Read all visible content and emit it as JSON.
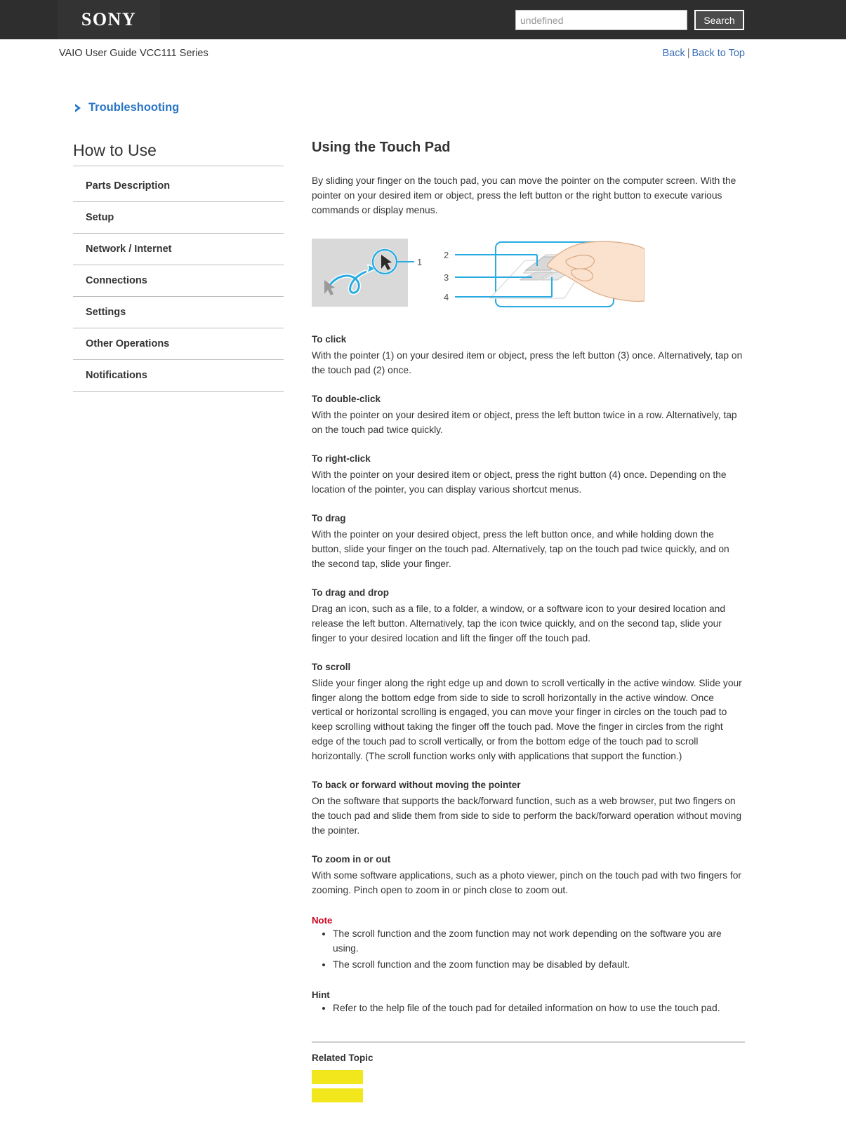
{
  "header": {
    "logo_text": "SONY",
    "search": {
      "value": "",
      "placeholder": "undefined",
      "button_label": "Search"
    },
    "guide_title": "VAIO User Guide VCC111 Series",
    "link_back": "Back",
    "link_separator": "|",
    "link_back_to_top": "Back to Top"
  },
  "breadcrumb": {
    "label": "Troubleshooting",
    "icon": "chevron-right-icon"
  },
  "sidebar": {
    "title": "How to Use",
    "items": [
      {
        "label": "Parts Description"
      },
      {
        "label": "Setup"
      },
      {
        "label": "Network / Internet"
      },
      {
        "label": "Connections"
      },
      {
        "label": "Settings"
      },
      {
        "label": "Other Operations"
      },
      {
        "label": "Notifications"
      }
    ]
  },
  "article": {
    "title": "Using the Touch Pad",
    "intro": "By sliding your finger on the touch pad, you can move the pointer on the computer screen. With the pointer on your desired item or object, press the left button or the right button to execute various commands or display menus.",
    "figures": {
      "left": {
        "name": "pointer-movement-illustration",
        "callouts": [
          "1"
        ]
      },
      "right": {
        "name": "hand-on-touchpad-illustration",
        "callouts": [
          "2",
          "3",
          "4"
        ]
      }
    },
    "sections": [
      {
        "heading": "To click",
        "body": "With the pointer (1) on your desired item or object, press the left button (3) once.\nAlternatively, tap on the touch pad (2) once."
      },
      {
        "heading": "To double-click",
        "body": "With the pointer on your desired item or object, press the left button twice in a row.\nAlternatively, tap on the touch pad twice quickly."
      },
      {
        "heading": "To right-click",
        "body": "With the pointer on your desired item or object, press the right button (4) once.\nDepending on the location of the pointer, you can display various shortcut menus."
      },
      {
        "heading": "To drag",
        "body": "With the pointer on your desired object, press the left button once, and while holding down the button, slide your finger on the touch pad.\nAlternatively, tap on the touch pad twice quickly, and on the second tap, slide your finger."
      },
      {
        "heading": "To drag and drop",
        "body": "Drag an icon, such as a file, to a folder, a window, or a software icon to your desired location and release the left button.\nAlternatively, tap the icon twice quickly, and on the second tap, slide your finger to your desired location and lift the finger off the touch pad."
      },
      {
        "heading": "To scroll",
        "body": "Slide your finger along the right edge up and down to scroll vertically in the active window.\nSlide your finger along the bottom edge from side to side to scroll horizontally in the active window.\nOnce vertical or horizontal scrolling is engaged, you can move your finger in circles on the touch pad to keep scrolling without taking the finger off the touch pad. Move the finger in circles from the right edge of the touch pad to scroll vertically, or from the bottom edge of the touch pad to scroll horizontally. (The scroll function works only with applications that support the function.)"
      },
      {
        "heading": "To back or forward without moving the pointer",
        "body": "On the software that supports the back/forward function, such as a web browser, put two fingers on the touch pad and slide them from side to side to perform the back/forward operation without moving the pointer."
      },
      {
        "heading": "To zoom in or out",
        "body": "With some software applications, such as a photo viewer, pinch on the touch pad with two fingers for zooming. Pinch open to zoom in or pinch close to zoom out."
      }
    ],
    "note": {
      "label": "Note",
      "items": [
        "The scroll function and the zoom function may not work depending on the software you are using.",
        "The scroll function and the zoom function may be disabled by default."
      ]
    },
    "hint": {
      "label": "Hint",
      "items": [
        "Refer to the help file of the touch pad for detailed information on how to use the touch pad."
      ]
    },
    "related": {
      "label": "Related Topic",
      "items": [
        {
          "label": ""
        },
        {
          "label": ""
        }
      ]
    }
  },
  "colors": {
    "topbar": "#2e2e2e",
    "link_blue": "#3b6fb6",
    "breadcrumb_blue": "#2a76c6",
    "note_red": "#d0021b",
    "highlight_yellow": "#f2e71d",
    "illustration_blue": "#29abe2"
  }
}
